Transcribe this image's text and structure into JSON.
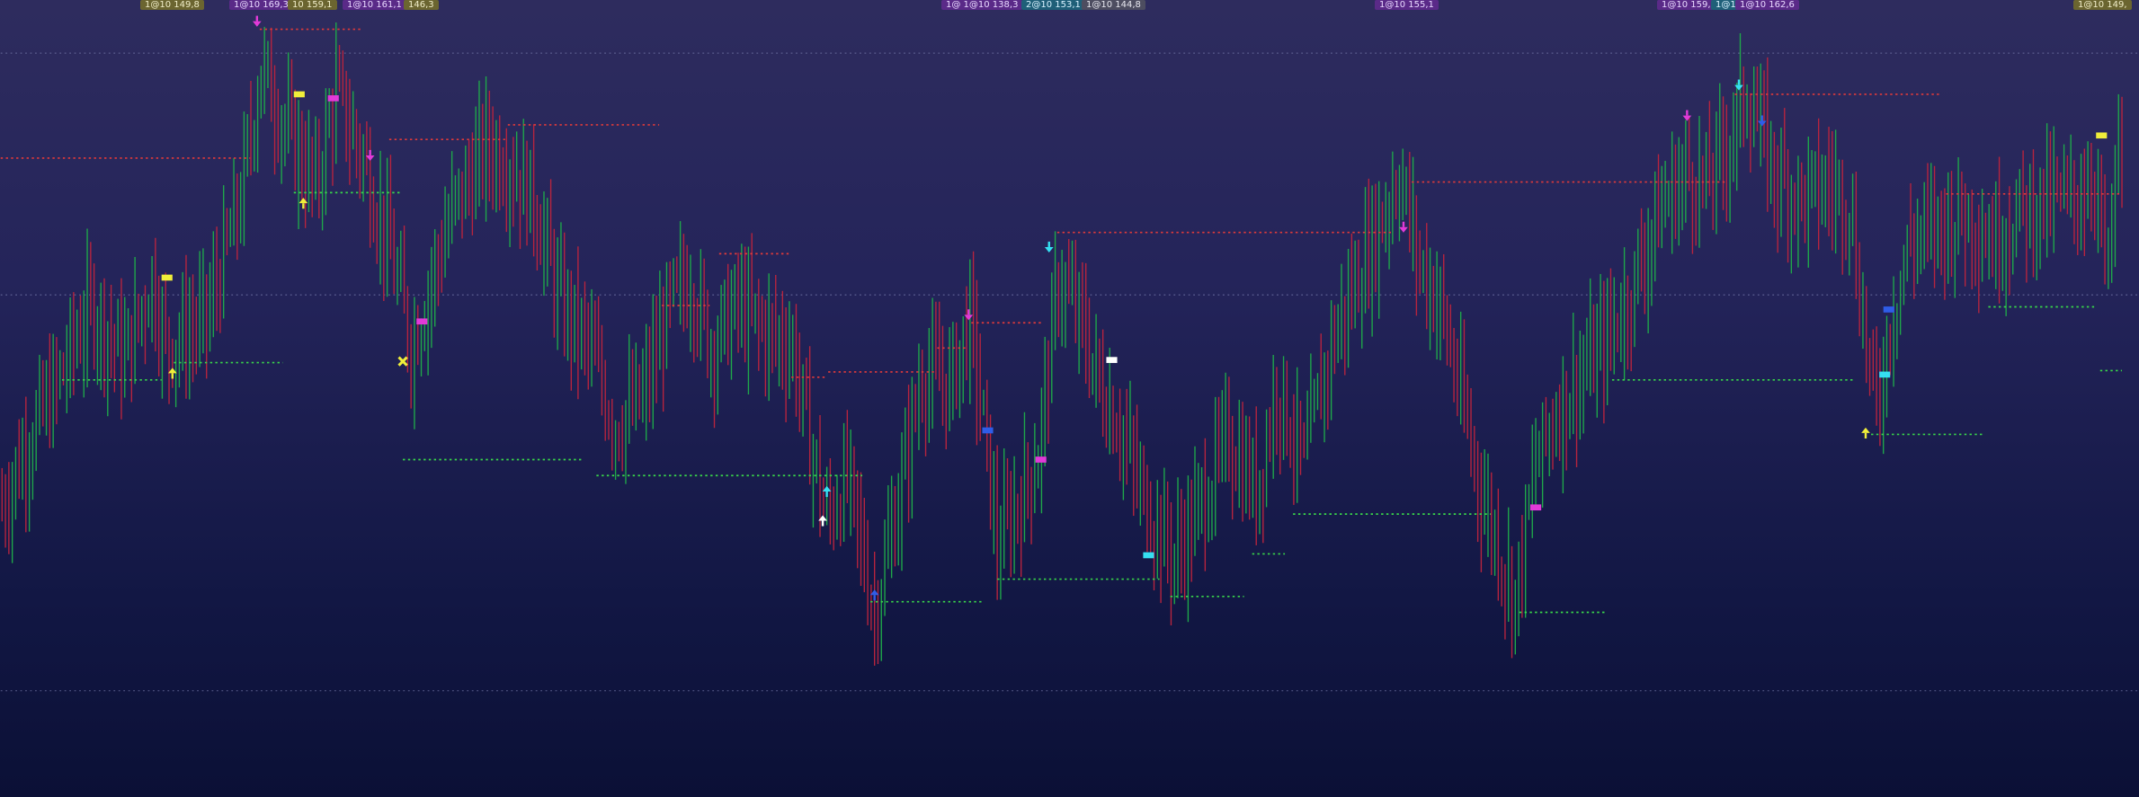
{
  "chart_data": {
    "type": "bar",
    "ylim": [
      113,
      173
    ],
    "grid": "dotted horizontal lines",
    "colors": {
      "up": "#1fa84a",
      "down": "#b8243e",
      "resistance": "#e03a3a",
      "support": "#39d64a",
      "magenta": "#e23ad8",
      "yellow": "#f0ee3a",
      "cyan": "#35e0f2",
      "blue": "#2f5de8",
      "white": "#ffffff"
    },
    "tags": [
      {
        "text": "1@10 149,8",
        "style": "olive"
      },
      {
        "text": "1@10 169,3",
        "style": "purple"
      },
      {
        "text": "10 159,1",
        "style": "olive"
      },
      {
        "text": "1@10 161,1",
        "style": "purple"
      },
      {
        "text": "146,3",
        "style": "olive"
      },
      {
        "text": "1@ 1@10 138,3",
        "style": "purple"
      },
      {
        "text": "2@10 153,1",
        "style": "teal"
      },
      {
        "text": "1@10 144,8",
        "style": "gray"
      },
      {
        "text": "1@10 155,1",
        "style": "purple"
      },
      {
        "text": "1@10 159,",
        "style": "purple"
      },
      {
        "text": "1@1",
        "style": "teal"
      },
      {
        "text": "1@10 162,6",
        "style": "purple"
      },
      {
        "text": "1@10 149,",
        "style": "olive"
      }
    ],
    "guide_lines": [
      169.0,
      150.8,
      121.0
    ],
    "waypoints": [
      [
        0,
        135
      ],
      [
        20,
        140
      ],
      [
        40,
        144
      ],
      [
        65,
        150
      ],
      [
        90,
        146
      ],
      [
        110,
        152
      ],
      [
        120,
        147
      ],
      [
        150,
        149
      ],
      [
        175,
        158
      ],
      [
        190,
        168
      ],
      [
        210,
        163
      ],
      [
        230,
        159
      ],
      [
        245,
        166
      ],
      [
        265,
        161
      ],
      [
        285,
        154
      ],
      [
        300,
        147
      ],
      [
        330,
        157
      ],
      [
        355,
        162
      ],
      [
        370,
        161
      ],
      [
        390,
        158
      ],
      [
        410,
        150
      ],
      [
        430,
        147
      ],
      [
        450,
        141
      ],
      [
        470,
        143
      ],
      [
        490,
        150
      ],
      [
        505,
        152
      ],
      [
        520,
        147
      ],
      [
        540,
        150
      ],
      [
        560,
        148
      ],
      [
        580,
        147
      ],
      [
        590,
        141
      ],
      [
        605,
        134
      ],
      [
        620,
        137
      ],
      [
        640,
        127
      ],
      [
        655,
        134
      ],
      [
        675,
        145
      ],
      [
        695,
        144
      ],
      [
        710,
        149
      ],
      [
        720,
        141
      ],
      [
        730,
        132
      ],
      [
        745,
        135
      ],
      [
        760,
        139
      ],
      [
        775,
        152
      ],
      [
        790,
        149
      ],
      [
        805,
        144
      ],
      [
        820,
        141
      ],
      [
        835,
        136
      ],
      [
        850,
        133
      ],
      [
        860,
        131
      ],
      [
        875,
        134
      ],
      [
        900,
        140
      ],
      [
        920,
        136
      ],
      [
        935,
        144
      ],
      [
        955,
        138
      ],
      [
        975,
        147
      ],
      [
        990,
        151
      ],
      [
        1010,
        156
      ],
      [
        1025,
        160
      ],
      [
        1040,
        153
      ],
      [
        1055,
        150
      ],
      [
        1070,
        143
      ],
      [
        1085,
        136
      ],
      [
        1100,
        131
      ],
      [
        1110,
        128
      ],
      [
        1125,
        138
      ],
      [
        1140,
        142
      ],
      [
        1160,
        145
      ],
      [
        1175,
        147
      ],
      [
        1195,
        151
      ],
      [
        1215,
        157
      ],
      [
        1235,
        160
      ],
      [
        1250,
        159
      ],
      [
        1265,
        162
      ],
      [
        1280,
        166
      ],
      [
        1300,
        160
      ],
      [
        1320,
        158
      ],
      [
        1340,
        159
      ],
      [
        1355,
        158
      ],
      [
        1365,
        149
      ],
      [
        1375,
        142
      ],
      [
        1385,
        149
      ],
      [
        1400,
        155
      ],
      [
        1420,
        156
      ],
      [
        1440,
        157
      ],
      [
        1460,
        155
      ],
      [
        1480,
        157
      ],
      [
        1500,
        158
      ],
      [
        1520,
        158
      ],
      [
        1535,
        160
      ],
      [
        1545,
        152
      ],
      [
        1552,
        162
      ]
    ],
    "levels": [
      {
        "kind": "resistance",
        "x1": 0,
        "x2": 183,
        "y": 161.1
      },
      {
        "kind": "resistance",
        "x1": 190,
        "x2": 265,
        "y": 170.8
      },
      {
        "kind": "resistance",
        "x1": 285,
        "x2": 370,
        "y": 162.5
      },
      {
        "kind": "resistance",
        "x1": 372,
        "x2": 483,
        "y": 163.6
      },
      {
        "kind": "resistance",
        "x1": 485,
        "x2": 520,
        "y": 150.0
      },
      {
        "kind": "resistance",
        "x1": 527,
        "x2": 580,
        "y": 153.9
      },
      {
        "kind": "resistance",
        "x1": 580,
        "x2": 605,
        "y": 144.6
      },
      {
        "kind": "resistance",
        "x1": 607,
        "x2": 685,
        "y": 145.0
      },
      {
        "kind": "resistance",
        "x1": 687,
        "x2": 708,
        "y": 146.8
      },
      {
        "kind": "resistance",
        "x1": 712,
        "x2": 765,
        "y": 148.7
      },
      {
        "kind": "resistance",
        "x1": 775,
        "x2": 1020,
        "y": 155.5
      },
      {
        "kind": "resistance",
        "x1": 1035,
        "x2": 1265,
        "y": 159.3
      },
      {
        "kind": "resistance",
        "x1": 1272,
        "x2": 1423,
        "y": 165.9
      },
      {
        "kind": "resistance",
        "x1": 1427,
        "x2": 1555,
        "y": 158.4
      },
      {
        "kind": "support",
        "x1": 45,
        "x2": 118,
        "y": 144.4
      },
      {
        "kind": "support",
        "x1": 127,
        "x2": 207,
        "y": 145.7
      },
      {
        "kind": "support",
        "x1": 215,
        "x2": 293,
        "y": 158.5
      },
      {
        "kind": "support",
        "x1": 295,
        "x2": 428,
        "y": 138.4
      },
      {
        "kind": "support",
        "x1": 437,
        "x2": 632,
        "y": 137.2
      },
      {
        "kind": "support",
        "x1": 638,
        "x2": 721,
        "y": 127.7
      },
      {
        "kind": "support",
        "x1": 731,
        "x2": 850,
        "y": 129.4
      },
      {
        "kind": "support",
        "x1": 858,
        "x2": 912,
        "y": 128.1
      },
      {
        "kind": "support",
        "x1": 918,
        "x2": 942,
        "y": 131.3
      },
      {
        "kind": "support",
        "x1": 948,
        "x2": 1093,
        "y": 134.3
      },
      {
        "kind": "support",
        "x1": 1114,
        "x2": 1178,
        "y": 126.9
      },
      {
        "kind": "support",
        "x1": 1182,
        "x2": 1360,
        "y": 144.4
      },
      {
        "kind": "support",
        "x1": 1372,
        "x2": 1455,
        "y": 140.3
      },
      {
        "kind": "support",
        "x1": 1458,
        "x2": 1537,
        "y": 149.9
      },
      {
        "kind": "support",
        "x1": 1540,
        "x2": 1556,
        "y": 145.1
      }
    ],
    "markers": [
      {
        "type": "arrow-down",
        "color": "magenta",
        "x": 188,
        "y": 171.4
      },
      {
        "type": "arrow-up",
        "color": "yellow",
        "x": 222,
        "y": 157.7
      },
      {
        "type": "arrow-down",
        "color": "magenta",
        "x": 271,
        "y": 161.3
      },
      {
        "type": "arrow-up",
        "color": "yellow",
        "x": 126,
        "y": 144.9
      },
      {
        "type": "arrow-down",
        "color": "cyan",
        "x": 769,
        "y": 154.4
      },
      {
        "type": "arrow-down",
        "color": "magenta",
        "x": 710,
        "y": 149.3
      },
      {
        "type": "arrow-up",
        "color": "cyan",
        "x": 606,
        "y": 136.0
      },
      {
        "type": "arrow-up",
        "color": "white",
        "x": 603,
        "y": 133.8
      },
      {
        "type": "arrow-up",
        "color": "blue",
        "x": 641,
        "y": 128.2
      },
      {
        "type": "arrow-down",
        "color": "magenta",
        "x": 1029,
        "y": 155.9
      },
      {
        "type": "arrow-down",
        "color": "magenta",
        "x": 1237,
        "y": 164.3
      },
      {
        "type": "arrow-down",
        "color": "cyan",
        "x": 1275,
        "y": 166.6
      },
      {
        "type": "arrow-down",
        "color": "blue",
        "x": 1292,
        "y": 163.9
      },
      {
        "type": "arrow-up",
        "color": "yellow",
        "x": 1368,
        "y": 140.4
      },
      {
        "type": "cross",
        "color": "yellow",
        "x": 295,
        "y": 145.8
      },
      {
        "type": "rect",
        "color": "yellow",
        "x": 122,
        "y": 152.1
      },
      {
        "type": "rect",
        "color": "yellow",
        "x": 219,
        "y": 165.9
      },
      {
        "type": "rect",
        "color": "magenta",
        "x": 244,
        "y": 165.6
      },
      {
        "type": "rect",
        "color": "magenta",
        "x": 309,
        "y": 148.8
      },
      {
        "type": "rect",
        "color": "white",
        "x": 815,
        "y": 145.9
      },
      {
        "type": "rect",
        "color": "blue",
        "x": 724,
        "y": 140.6
      },
      {
        "type": "rect",
        "color": "magenta",
        "x": 763,
        "y": 138.4
      },
      {
        "type": "rect",
        "color": "cyan",
        "x": 842,
        "y": 131.2
      },
      {
        "type": "rect",
        "color": "magenta",
        "x": 1126,
        "y": 134.8
      },
      {
        "type": "rect",
        "color": "blue",
        "x": 1385,
        "y": 149.7
      },
      {
        "type": "rect",
        "color": "cyan",
        "x": 1382,
        "y": 144.8
      },
      {
        "type": "rect",
        "color": "yellow",
        "x": 1541,
        "y": 162.8
      }
    ]
  }
}
